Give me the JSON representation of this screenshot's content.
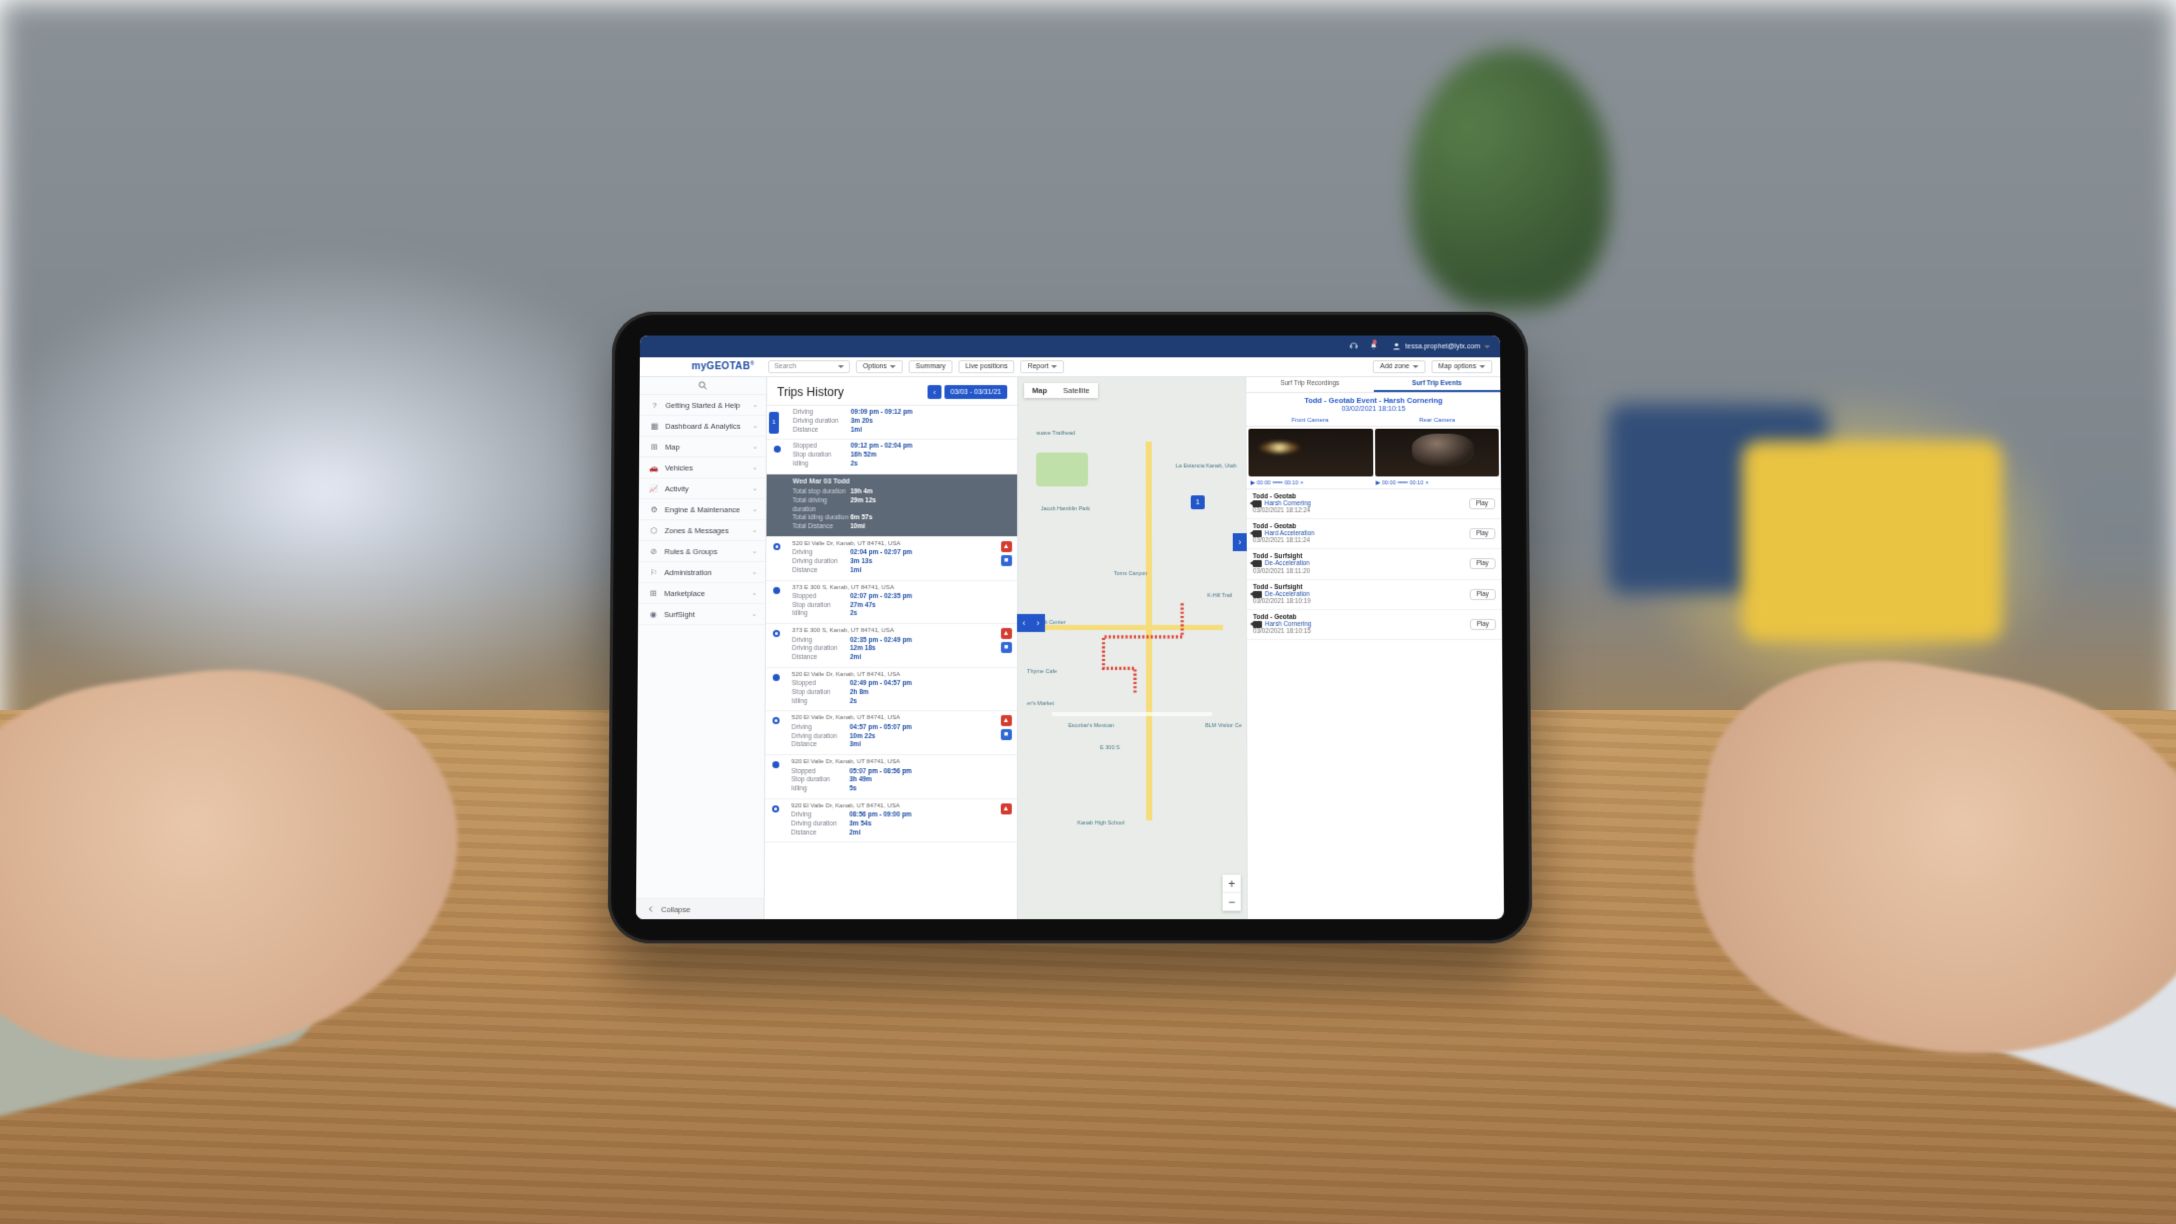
{
  "brand": {
    "prefix": "my",
    "name": "GEOTAB"
  },
  "topbar": {
    "user": "tessa.prophet@lytx.com"
  },
  "toolbar": {
    "search_placeholder": "Search",
    "options": "Options",
    "summary": "Summary",
    "live_positions": "Live positions",
    "report": "Report",
    "add_zone": "Add zone",
    "map_options": "Map options"
  },
  "sidebar": {
    "items": [
      {
        "label": "Getting Started & Help",
        "icon": "help"
      },
      {
        "label": "Dashboard & Analytics",
        "icon": "dash"
      },
      {
        "label": "Map",
        "icon": "map"
      },
      {
        "label": "Vehicles",
        "icon": "car"
      },
      {
        "label": "Activity",
        "icon": "activity"
      },
      {
        "label": "Engine & Maintenance",
        "icon": "gear"
      },
      {
        "label": "Zones & Messages",
        "icon": "zone"
      },
      {
        "label": "Rules & Groups",
        "icon": "rules"
      },
      {
        "label": "Administration",
        "icon": "admin"
      },
      {
        "label": "Marketplace",
        "icon": "market"
      },
      {
        "label": "SurfSight",
        "icon": "radio"
      }
    ],
    "collapse": "Collapse"
  },
  "trips_header": {
    "title": "Trips History",
    "date_range": "03/03 - 03/31/21"
  },
  "map": {
    "tab_map": "Map",
    "tab_sat": "Satellite",
    "pois": [
      "Jacob Hamblin Park",
      "La Estancia Kanab, Utah",
      "Toms Canyon",
      "K-Hill Trail",
      "Kanab Center",
      "Thyme Cafe",
      "er's Market",
      "Escobar's Mexican",
      "E 300 S",
      "BLM Visitor Ce",
      "Kanab High School",
      "suave Trailhead"
    ]
  },
  "right": {
    "tab_recordings": "Surf Trip Recordings",
    "tab_events": "Surf Trip Events",
    "event_title": "Todd - Geotab Event - Harsh Cornering",
    "event_time": "03/02/2021 18:10:15",
    "cam_front": "Front Camera",
    "cam_rear": "Rear Camera",
    "ctrl_time": "00:00",
    "ctrl_time2": "00:10",
    "events": [
      {
        "who": "Todd - Geotab",
        "what": "Harsh Cornering",
        "when": "03/02/2021 18:12:24"
      },
      {
        "who": "Todd - Geotab",
        "what": "Hard Acceleration",
        "when": "03/02/2021 18:11:24"
      },
      {
        "who": "Todd - Surfsight",
        "what": "De-Acceleration",
        "when": "03/02/2021 18:11:20"
      },
      {
        "who": "Todd - Surfsight",
        "what": "De-Acceleration",
        "when": "03/02/2021 18:10:19"
      },
      {
        "who": "Todd - Geotab",
        "what": "Harsh Cornering",
        "when": "03/02/2021 18:10:15"
      }
    ],
    "play": "Play"
  },
  "trips": [
    {
      "type": "drive",
      "badge": "1",
      "lines": [
        {
          "k": "Driving",
          "v": "09:09 pm - 09:12 pm"
        },
        {
          "k": "Driving duration",
          "v": "3m 20s"
        },
        {
          "k": "Distance",
          "v": "1mi"
        }
      ]
    },
    {
      "type": "stop",
      "lines": [
        {
          "k": "Stopped",
          "v": "09:12 pm - 02:04 pm"
        },
        {
          "k": "Stop duration",
          "v": "16h 52m"
        },
        {
          "k": "Idling",
          "v": "2s"
        }
      ]
    },
    {
      "type": "summary",
      "hdr": "Wed Mar 03   Todd",
      "lines": [
        {
          "k": "Total stop duration",
          "v": "19h 4m"
        },
        {
          "k": "Total driving duration",
          "v": "29m 12s"
        },
        {
          "k": "Total idling duration",
          "v": "6m 57s"
        },
        {
          "k": "Total Distance",
          "v": "10mi"
        }
      ]
    },
    {
      "type": "drive",
      "addr": "520 El Valle Dr, Kanab, UT 84741, USA",
      "icons": [
        "red",
        "blue"
      ],
      "lines": [
        {
          "k": "Driving",
          "v": "02:04 pm - 02:07 pm"
        },
        {
          "k": "Driving duration",
          "v": "3m 13s"
        },
        {
          "k": "Distance",
          "v": "1mi"
        }
      ]
    },
    {
      "type": "stop",
      "addr": "373 E 300 S, Kanab, UT 84741, USA",
      "lines": [
        {
          "k": "Stopped",
          "v": "02:07 pm - 02:35 pm"
        },
        {
          "k": "Stop duration",
          "v": "27m 47s"
        },
        {
          "k": "Idling",
          "v": "2s"
        }
      ]
    },
    {
      "type": "drive",
      "addr": "373 E 300 S, Kanab, UT 84741, USA",
      "icons": [
        "red",
        "blue"
      ],
      "lines": [
        {
          "k": "Driving",
          "v": "02:35 pm - 02:49 pm"
        },
        {
          "k": "Driving duration",
          "v": "12m 18s"
        },
        {
          "k": "Distance",
          "v": "2mi"
        }
      ]
    },
    {
      "type": "stop",
      "addr": "520 El Valle Dr, Kanab, UT 84741, USA",
      "lines": [
        {
          "k": "Stopped",
          "v": "02:49 pm - 04:57 pm"
        },
        {
          "k": "Stop duration",
          "v": "2h 8m"
        },
        {
          "k": "Idling",
          "v": "2s"
        }
      ]
    },
    {
      "type": "drive",
      "addr": "520 El Valle Dr, Kanab, UT 84741, USA",
      "icons": [
        "red",
        "blue"
      ],
      "lines": [
        {
          "k": "Driving",
          "v": "04:57 pm - 05:07 pm"
        },
        {
          "k": "Driving duration",
          "v": "10m 22s"
        },
        {
          "k": "Distance",
          "v": "3mi"
        }
      ]
    },
    {
      "type": "stop",
      "addr": "920 El Valle Dr, Kanab, UT 84741, USA",
      "lines": [
        {
          "k": "Stopped",
          "v": "05:07 pm - 08:56 pm"
        },
        {
          "k": "Stop duration",
          "v": "3h 49m"
        },
        {
          "k": "Idling",
          "v": "5s"
        }
      ]
    },
    {
      "type": "drive",
      "addr": "920 El Valle Dr, Kanab, UT 84741, USA",
      "icons": [
        "red"
      ],
      "lines": [
        {
          "k": "Driving",
          "v": "08:56 pm - 09:00 pm"
        },
        {
          "k": "Driving duration",
          "v": "3m 54s"
        },
        {
          "k": "Distance",
          "v": "2mi"
        }
      ]
    }
  ]
}
